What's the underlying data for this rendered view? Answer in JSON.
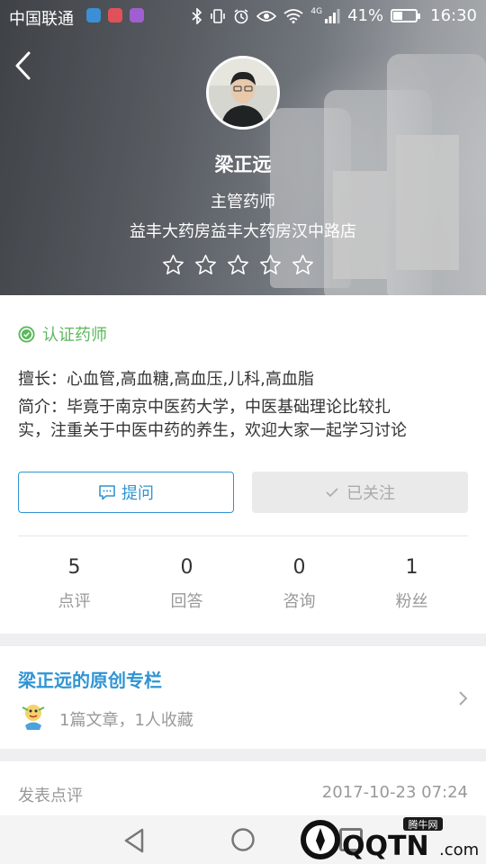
{
  "status_bar": {
    "carrier": "中国联通",
    "battery_percent": "41%",
    "battery_level": 0.41,
    "time": "16:30",
    "network": "4G"
  },
  "pharmacist": {
    "name": "梁正远",
    "title": "主管药师",
    "store": "益丰大药房益丰大药房汉中路店",
    "rating": 0,
    "rating_max": 5
  },
  "profile": {
    "certified_label": "认证药师",
    "specialty": "擅长：心血管,高血糖,高血压,儿科,高血脂",
    "intro_line1": "简介：毕竟于南京中医药大学，中医基础理论比较扎",
    "intro_line2": "实，注重关于中医中药的养生，欢迎大家一起学习讨论"
  },
  "actions": {
    "ask_label": "提问",
    "follow_label": "已关注"
  },
  "stats": [
    {
      "value": "5",
      "label": "点评"
    },
    {
      "value": "0",
      "label": "回答"
    },
    {
      "value": "0",
      "label": "咨询"
    },
    {
      "value": "1",
      "label": "粉丝"
    }
  ],
  "column": {
    "title": "梁正远的原创专栏",
    "meta": "1篇文章，1人收藏"
  },
  "review": {
    "label": "发表点评",
    "date": "2017-10-23 07:24"
  },
  "watermark": {
    "top_text": "腾牛网",
    "brand": "QQTN",
    "suffix": ".com"
  },
  "colors": {
    "accent": "#2f94d4",
    "certified": "#5cb85c",
    "muted": "#999999"
  },
  "icons": {
    "back": "chevron-left-icon",
    "cert": "check-circle-icon",
    "ask": "chat-bubble-icon",
    "follow": "checkmark-icon",
    "star": "star-outline-icon",
    "column_arrow": "chevron-right-icon"
  }
}
